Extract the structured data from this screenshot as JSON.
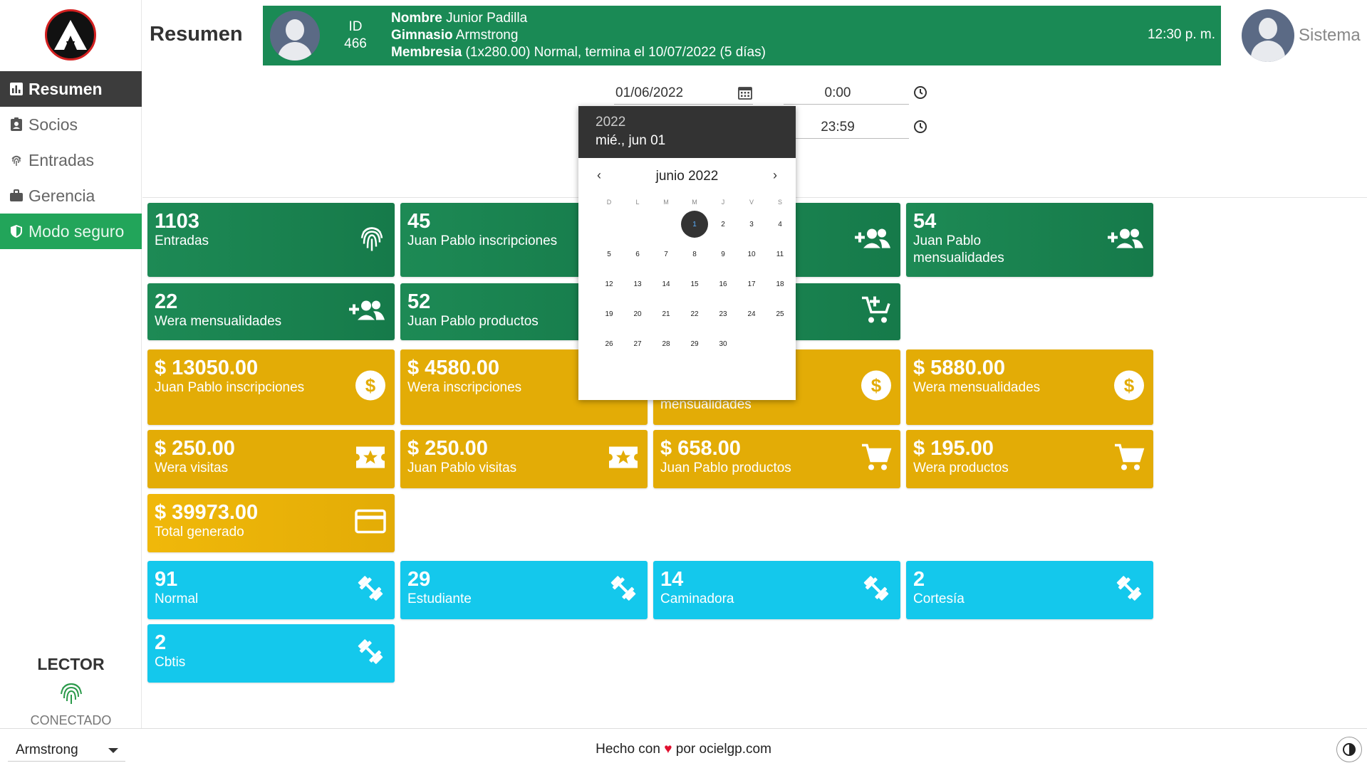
{
  "sidebar": {
    "items": [
      {
        "label": "Resumen",
        "icon": "chart-icon"
      },
      {
        "label": "Socios",
        "icon": "id-badge-icon"
      },
      {
        "label": "Entradas",
        "icon": "fingerprint-icon"
      },
      {
        "label": "Gerencia",
        "icon": "briefcase-icon"
      },
      {
        "label": "Modo seguro",
        "icon": "shield-icon"
      }
    ],
    "lector_title": "LECTOR",
    "lector_status": "CONECTADO"
  },
  "header": {
    "title": "Resumen",
    "member": {
      "id_label": "ID",
      "id_value": "466",
      "name_key": "Nombre",
      "name_value": " Junior Padilla",
      "gym_key": "Gimnasio",
      "gym_value": " Armstrong",
      "membership_key": "Membresia",
      "membership_value": " (1x280.00) Normal, termina el 10/07/2022 (5 días)",
      "time": "12:30 p. m."
    },
    "user": "Sistema"
  },
  "filters": {
    "start_date": "01/06/2022",
    "start_time": "0:00",
    "end_time": "23:59"
  },
  "datepicker": {
    "year": "2022",
    "selected_label": "mié., jun 01",
    "month_label": "junio 2022",
    "weekdays": [
      "D",
      "L",
      "M",
      "M",
      "J",
      "V",
      "S"
    ],
    "days": [
      "",
      "",
      "",
      "1",
      "2",
      "3",
      "4",
      "5",
      "6",
      "7",
      "8",
      "9",
      "10",
      "11",
      "12",
      "13",
      "14",
      "15",
      "16",
      "17",
      "18",
      "19",
      "20",
      "21",
      "22",
      "23",
      "24",
      "25",
      "26",
      "27",
      "28",
      "29",
      "30"
    ],
    "selected_day": "1"
  },
  "cards": {
    "c1": {
      "value": "1103",
      "label": "Entradas"
    },
    "c2": {
      "value": "45",
      "label": "Juan Pablo inscripciones"
    },
    "c4": {
      "value": "54",
      "label": "Juan Pablo mensualidades"
    },
    "c5": {
      "value": "22",
      "label": "Wera mensualidades"
    },
    "c6": {
      "value": "52",
      "label": "Juan Pablo productos"
    },
    "c9": {
      "value": "$ 13050.00",
      "label": "Juan Pablo inscripciones"
    },
    "c10": {
      "value": "$ 4580.00",
      "label": "Wera inscripciones"
    },
    "c11": {
      "value": "",
      "label": "mensualidades"
    },
    "c12": {
      "value": "$ 5880.00",
      "label": "Wera mensualidades"
    },
    "c13": {
      "value": "$ 250.00",
      "label": "Wera visitas"
    },
    "c14": {
      "value": "$ 250.00",
      "label": "Juan Pablo visitas"
    },
    "c15": {
      "value": "$ 658.00",
      "label": "Juan Pablo productos"
    },
    "c16": {
      "value": "$ 195.00",
      "label": "Wera productos"
    },
    "c17": {
      "value": "$ 39973.00",
      "label": "Total generado"
    },
    "c18": {
      "value": "91",
      "label": "Normal"
    },
    "c19": {
      "value": "29",
      "label": "Estudiante"
    },
    "c20": {
      "value": "14",
      "label": "Caminadora"
    },
    "c21": {
      "value": "2",
      "label": "Cortesía"
    },
    "c22": {
      "value": "2",
      "label": "Cbtis"
    }
  },
  "footer": {
    "gym_select": "Armstrong",
    "credit_pre": "Hecho con ",
    "credit_heart": "♥",
    "credit_post": " por ocielgp.com"
  },
  "colors": {
    "green": "#1d8a55",
    "yellow": "#e3ac06",
    "cyan": "#14c8ec",
    "secure": "#22a55a"
  }
}
